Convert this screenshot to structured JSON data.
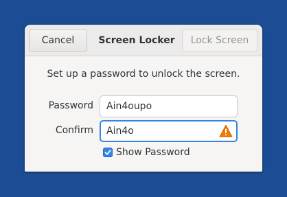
{
  "dialog": {
    "title": "Screen Locker",
    "cancel_label": "Cancel",
    "lock_label": "Lock Screen",
    "instruction": "Set up a password to unlock the screen.",
    "password": {
      "label": "Password",
      "value": "Ain4oupo"
    },
    "confirm": {
      "label": "Confirm",
      "value": "Ain4o",
      "status_icon": "warning-icon"
    },
    "show_password": {
      "label": "Show Password",
      "checked": true
    }
  },
  "colors": {
    "desktop_background": "#1c4c94",
    "accent": "#3584e4",
    "warning": "#f57900"
  }
}
